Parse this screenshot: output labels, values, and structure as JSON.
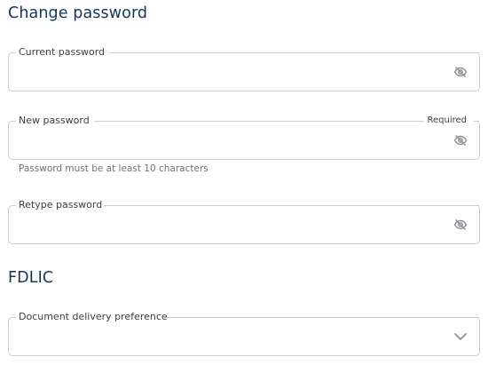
{
  "sections": {
    "change_password": {
      "title": "Change password",
      "current_password": {
        "label": "Current password",
        "value": ""
      },
      "new_password": {
        "label": "New password",
        "required_text": "Required",
        "value": "",
        "hint": "Password must be at least 10 characters"
      },
      "retype_password": {
        "label": "Retype password",
        "value": ""
      }
    },
    "fdlic": {
      "title": "FDLIC",
      "document_delivery": {
        "label": "Document delivery preference",
        "selected": ""
      }
    }
  },
  "icons": {
    "password_toggle": "eye-slash-icon",
    "dropdown": "chevron-down-icon"
  },
  "colors": {
    "heading": "#14365d",
    "border": "#c9cdd2",
    "icon": "#8a9097"
  }
}
